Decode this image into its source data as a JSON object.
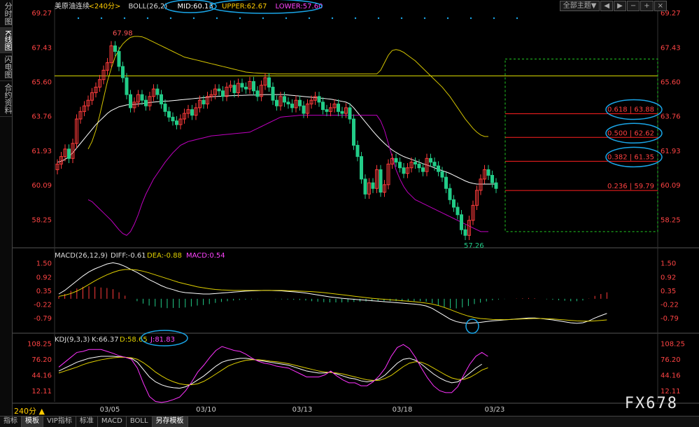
{
  "sidebar": {
    "tabs": [
      {
        "label": "分时图",
        "active": false
      },
      {
        "label": "K线图",
        "active": true
      },
      {
        "label": "闪电图",
        "active": false
      },
      {
        "label": "合约资料",
        "active": false
      }
    ]
  },
  "header": {
    "symbol": "美原油连续",
    "period": "<240分>",
    "boll": "BOLL(26,2)",
    "mid": "MID:60.13",
    "upper": "UPPER:62.67",
    "lower": "LOWER:57.60",
    "theme_button": "全部主题▼"
  },
  "macd_header": {
    "name": "MACD(26,12,9)",
    "diff": "DIFF:-0.61",
    "dea": "DEA:-0.88",
    "macd": "MACD:0.54"
  },
  "kdj_header": {
    "name": "KDJ(9,3,3)",
    "k": "K:66.37",
    "d": "D:58.65",
    "j": "J:81.83"
  },
  "timeframe": "240分 ▲",
  "watermark": "FX678",
  "bottom_tabs": [
    {
      "label": "指标",
      "active": false
    },
    {
      "label": "模板",
      "active": true
    },
    {
      "label": "VIP指标",
      "active": false
    },
    {
      "label": "标准",
      "active": false
    },
    {
      "label": "MACD",
      "active": false
    },
    {
      "label": "BOLL",
      "active": false
    },
    {
      "label": "另存模板",
      "active": true
    }
  ],
  "colors": {
    "up": "#ff3b3b",
    "down": "#22cc88",
    "mid": "#ffffff",
    "upper": "#d4c400",
    "lower": "#c000c0",
    "fib": "#ff2020",
    "annot": "#1aa6e8"
  },
  "chart_data": {
    "type": "candlestick",
    "main": {
      "ylim": [
        57.26,
        69.27
      ],
      "y_ticks": [
        "69.27",
        "67.43",
        "65.60",
        "63.76",
        "61.93",
        "60.09",
        "58.25"
      ],
      "x_ticks": [
        {
          "i": 10,
          "label": "03/05"
        },
        {
          "i": 35,
          "label": "03/10"
        },
        {
          "i": 60,
          "label": "03/13"
        },
        {
          "i": 86,
          "label": "03/18"
        },
        {
          "i": 110,
          "label": "03/23"
        }
      ],
      "high_label": "67.98",
      "low_label": "57.26",
      "hline": 65.9,
      "fib_levels": [
        {
          "label": "0.618 | 63.88",
          "value": 63.88
        },
        {
          "label": "0.500 | 62.62",
          "value": 62.62
        },
        {
          "label": "0.382 | 61.35",
          "value": 61.35
        },
        {
          "label": "0.236 | 59.79",
          "value": 59.79
        }
      ],
      "closes": [
        61.2,
        61.6,
        62.0,
        61.5,
        62.3,
        63.6,
        64.0,
        64.3,
        64.6,
        65.0,
        65.3,
        65.7,
        66.2,
        66.6,
        67.5,
        67.2,
        66.4,
        65.8,
        64.9,
        64.2,
        64.5,
        64.9,
        64.6,
        64.3,
        64.8,
        65.2,
        64.9,
        64.4,
        64.0,
        63.7,
        63.5,
        63.3,
        63.6,
        63.9,
        64.1,
        63.8,
        64.2,
        64.6,
        64.4,
        64.8,
        64.9,
        65.2,
        65.1,
        64.8,
        65.3,
        65.4,
        65.0,
        65.5,
        65.3,
        65.2,
        65.6,
        65.1,
        64.8,
        65.4,
        65.8,
        65.3,
        64.6,
        64.3,
        64.8,
        64.5,
        64.4,
        64.2,
        64.6,
        64.3,
        63.9,
        64.4,
        64.6,
        64.8,
        64.5,
        64.1,
        64.0,
        64.2,
        64.4,
        64.0,
        63.9,
        64.2,
        63.6,
        62.2,
        61.6,
        60.4,
        59.6,
        60.2,
        59.9,
        60.9,
        59.7,
        60.1,
        61.2,
        61.5,
        61.3,
        61.0,
        60.7,
        61.0,
        61.3,
        61.2,
        61.0,
        60.8,
        61.5,
        61.3,
        61.1,
        60.8,
        60.5,
        59.9,
        59.3,
        58.9,
        58.5,
        57.7,
        57.4,
        58.2,
        59.0,
        59.8,
        60.4,
        60.9,
        60.6,
        60.2,
        59.9
      ],
      "mid": [
        61.3,
        61.35,
        61.45,
        61.6,
        61.8,
        62.05,
        62.3,
        62.55,
        62.8,
        63.05,
        63.3,
        63.5,
        63.7,
        63.9,
        64.05,
        64.15,
        64.25,
        64.3,
        64.35,
        64.37,
        64.38,
        64.4,
        64.42,
        64.45,
        64.48,
        64.5,
        64.52,
        64.54,
        64.55,
        64.56,
        64.58,
        64.6,
        64.62,
        64.64,
        64.66,
        64.68,
        64.7,
        64.72,
        64.74,
        64.76,
        64.78,
        64.8,
        64.81,
        64.82,
        64.83,
        64.84,
        64.85,
        64.86,
        64.86,
        64.87,
        64.88,
        64.88,
        64.88,
        64.89,
        64.9,
        64.9,
        64.9,
        64.9,
        64.9,
        64.9,
        64.88,
        64.86,
        64.84,
        64.82,
        64.8,
        64.78,
        64.76,
        64.74,
        64.72,
        64.7,
        64.68,
        64.66,
        64.62,
        64.58,
        64.54,
        64.5,
        64.4,
        64.2,
        63.95,
        63.7,
        63.45,
        63.2,
        62.95,
        62.72,
        62.5,
        62.3,
        62.12,
        61.95,
        61.82,
        61.7,
        61.6,
        61.52,
        61.45,
        61.38,
        61.3,
        61.22,
        61.15,
        61.08,
        61.0,
        60.92,
        60.85,
        60.78,
        60.7,
        60.6,
        60.5,
        60.4,
        60.3,
        60.22,
        60.17,
        60.13,
        60.13,
        60.13,
        60.13,
        60.13,
        60.13
      ],
      "upper": [
        62.0,
        62.4,
        63.0,
        63.8,
        64.7,
        65.6,
        66.3,
        66.9,
        67.3,
        67.6,
        67.8,
        67.95,
        68.0,
        68.0,
        67.98,
        67.9,
        67.8,
        67.7,
        67.6,
        67.5,
        67.4,
        67.3,
        67.2,
        67.1,
        67.0,
        66.9,
        66.85,
        66.8,
        66.75,
        66.7,
        66.65,
        66.6,
        66.55,
        66.5,
        66.45,
        66.4,
        66.35,
        66.3,
        66.25,
        66.2,
        66.15,
        66.1,
        66.08,
        66.06,
        66.05,
        66.04,
        66.03,
        66.02,
        66.01,
        66.0,
        66.0,
        66.0,
        66.0,
        66.0,
        66.0,
        66.0,
        66.0,
        66.0,
        66.0,
        66.0,
        66.0,
        66.0,
        66.0,
        66.0,
        66.0,
        66.0,
        66.0,
        66.0,
        66.0,
        66.0,
        66.0,
        66.0,
        66.0,
        66.0,
        66.0,
        66.0,
        66.2,
        66.6,
        67.0,
        67.25,
        67.3,
        67.25,
        67.15,
        67.0,
        66.85,
        66.7,
        66.5,
        66.3,
        66.1,
        65.9,
        65.7,
        65.5,
        65.3,
        65.05,
        64.8,
        64.5,
        64.2,
        63.9,
        63.6,
        63.35,
        63.1,
        62.9,
        62.75,
        62.67,
        62.67
      ],
      "lower": [
        59.3,
        59.2,
        59.0,
        58.8,
        58.6,
        58.4,
        58.2,
        57.95,
        57.7,
        57.5,
        57.4,
        57.6,
        58.0,
        58.5,
        59.1,
        59.6,
        60.0,
        60.4,
        60.7,
        61.0,
        61.3,
        61.55,
        61.8,
        62.0,
        62.2,
        62.3,
        62.4,
        62.45,
        62.5,
        62.55,
        62.6,
        62.65,
        62.7,
        62.72,
        62.74,
        62.76,
        62.78,
        62.8,
        62.82,
        62.84,
        62.86,
        62.88,
        62.9,
        63.0,
        63.1,
        63.2,
        63.3,
        63.4,
        63.5,
        63.6,
        63.7,
        63.72,
        63.74,
        63.76,
        63.78,
        63.8,
        63.8,
        63.8,
        63.8,
        63.8,
        63.8,
        63.8,
        63.8,
        63.8,
        63.8,
        63.8,
        63.8,
        63.8,
        63.8,
        63.8,
        63.8,
        63.8,
        63.8,
        63.8,
        63.8,
        63.8,
        63.5,
        63.0,
        62.3,
        61.6,
        60.9,
        60.4,
        60.0,
        59.7,
        59.5,
        59.3,
        59.2,
        59.1,
        59.0,
        58.9,
        58.8,
        58.7,
        58.6,
        58.5,
        58.4,
        58.3,
        58.2,
        58.1,
        58.0,
        57.9,
        57.8,
        57.7,
        57.6,
        57.6,
        57.6
      ],
      "upper_offset": 8,
      "lower_offset": 8
    },
    "macd": {
      "y_ticks": [
        "1.50",
        "0.92",
        "0.35",
        "-0.22",
        "-0.79"
      ],
      "ylim": [
        -1.2,
        1.6
      ],
      "diff": [
        0.2,
        0.35,
        0.55,
        0.75,
        0.95,
        1.12,
        1.25,
        1.35,
        1.45,
        1.5,
        1.45,
        1.35,
        1.22,
        1.1,
        0.95,
        0.8,
        0.68,
        0.55,
        0.45,
        0.38,
        0.3,
        0.26,
        0.24,
        0.22,
        0.2,
        0.2,
        0.22,
        0.24,
        0.26,
        0.28,
        0.3,
        0.32,
        0.33,
        0.34,
        0.35,
        0.35,
        0.34,
        0.33,
        0.31,
        0.29,
        0.27,
        0.24,
        0.2,
        0.16,
        0.12,
        0.08,
        0.05,
        0.02,
        0.0,
        -0.02,
        -0.04,
        -0.06,
        -0.08,
        -0.1,
        -0.12,
        -0.14,
        -0.16,
        -0.18,
        -0.2,
        -0.22,
        -0.25,
        -0.3,
        -0.4,
        -0.55,
        -0.7,
        -0.85,
        -0.95,
        -1.0,
        -1.02,
        -1.0,
        -0.98,
        -0.95,
        -0.92,
        -0.9,
        -0.88,
        -0.86,
        -0.84,
        -0.82,
        -0.8,
        -0.8,
        -0.82,
        -0.85,
        -0.88,
        -0.92,
        -0.96,
        -1.0,
        -1.02,
        -1.0,
        -0.92,
        -0.8,
        -0.7,
        -0.61
      ],
      "dea": [
        0.1,
        0.15,
        0.22,
        0.32,
        0.45,
        0.6,
        0.75,
        0.88,
        1.0,
        1.1,
        1.18,
        1.22,
        1.22,
        1.2,
        1.15,
        1.08,
        1.0,
        0.92,
        0.84,
        0.76,
        0.68,
        0.62,
        0.56,
        0.5,
        0.46,
        0.42,
        0.39,
        0.37,
        0.36,
        0.35,
        0.35,
        0.35,
        0.35,
        0.35,
        0.35,
        0.35,
        0.35,
        0.35,
        0.34,
        0.33,
        0.32,
        0.31,
        0.3,
        0.28,
        0.26,
        0.23,
        0.2,
        0.17,
        0.14,
        0.11,
        0.08,
        0.05,
        0.02,
        0.0,
        -0.02,
        -0.04,
        -0.06,
        -0.08,
        -0.1,
        -0.12,
        -0.15,
        -0.18,
        -0.22,
        -0.28,
        -0.36,
        -0.45,
        -0.55,
        -0.64,
        -0.72,
        -0.78,
        -0.82,
        -0.84,
        -0.86,
        -0.87,
        -0.87,
        -0.86,
        -0.85,
        -0.84,
        -0.83,
        -0.82,
        -0.82,
        -0.83,
        -0.84,
        -0.86,
        -0.88,
        -0.9,
        -0.92,
        -0.93,
        -0.93,
        -0.92,
        -0.9,
        -0.88
      ],
      "start_offset": 3
    },
    "kdj": {
      "y_ticks": [
        "108.25",
        "76.20",
        "44.16",
        "12.11"
      ],
      "ylim": [
        -5,
        112
      ],
      "k": [
        52,
        58,
        64,
        70,
        74,
        78,
        80,
        82,
        82,
        82,
        81,
        80,
        78,
        70,
        55,
        40,
        30,
        24,
        20,
        18,
        17,
        20,
        26,
        34,
        42,
        52,
        62,
        70,
        74,
        76,
        78,
        78,
        76,
        74,
        72,
        70,
        68,
        66,
        64,
        60,
        56,
        52,
        50,
        48,
        48,
        50,
        46,
        42,
        38,
        36,
        32,
        30,
        32,
        36,
        44,
        56,
        68,
        76,
        78,
        74,
        66,
        56,
        46,
        38,
        32,
        28,
        30,
        38,
        48,
        58,
        66
      ],
      "d": [
        48,
        52,
        56,
        60,
        65,
        69,
        72,
        75,
        77,
        79,
        80,
        80,
        79,
        76,
        69,
        60,
        50,
        42,
        35,
        30,
        26,
        24,
        24,
        26,
        31,
        38,
        46,
        54,
        62,
        67,
        71,
        74,
        75,
        75,
        74,
        72,
        71,
        69,
        67,
        64,
        61,
        58,
        55,
        52,
        50,
        49,
        48,
        46,
        43,
        40,
        37,
        34,
        33,
        33,
        37,
        43,
        52,
        61,
        68,
        71,
        70,
        65,
        58,
        51,
        44,
        38,
        35,
        35,
        39,
        46,
        54,
        58.65
      ],
      "j": [
        60,
        70,
        80,
        90,
        92,
        96,
        96,
        96,
        92,
        88,
        83,
        80,
        76,
        58,
        27,
        0,
        -10,
        -12,
        -10,
        -6,
        -1,
        12,
        30,
        50,
        64,
        80,
        94,
        102,
        98,
        94,
        92,
        86,
        78,
        72,
        68,
        66,
        62,
        60,
        58,
        52,
        46,
        40,
        40,
        40,
        44,
        52,
        42,
        34,
        28,
        28,
        22,
        22,
        30,
        42,
        58,
        82,
        100,
        106,
        98,
        80,
        58,
        38,
        22,
        12,
        8,
        8,
        20,
        44,
        66,
        82,
        90,
        81.83
      ],
      "start_offset": 0
    }
  }
}
